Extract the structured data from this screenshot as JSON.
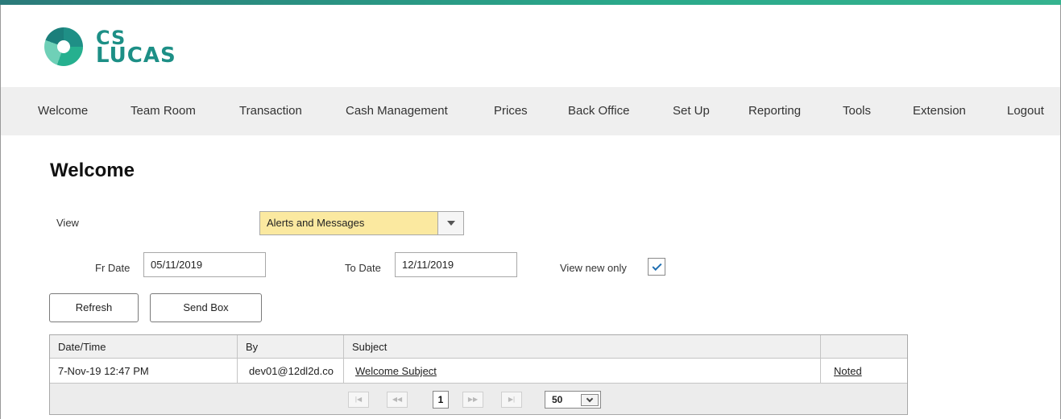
{
  "brand": {
    "line1": "CS",
    "line2": "LUCAS",
    "primary_color": "#1d8f86"
  },
  "nav": {
    "items": [
      {
        "label": "Welcome"
      },
      {
        "label": "Team Room"
      },
      {
        "label": "Transaction"
      },
      {
        "label": "Cash Management"
      },
      {
        "label": "Prices"
      },
      {
        "label": "Back Office"
      },
      {
        "label": "Set Up"
      },
      {
        "label": "Reporting"
      },
      {
        "label": "Tools"
      },
      {
        "label": "Extension"
      },
      {
        "label": "Logout"
      }
    ]
  },
  "page": {
    "title": "Welcome"
  },
  "filters": {
    "view_label": "View",
    "view_value": "Alerts and Messages",
    "from_date_label": "Fr Date",
    "from_date_value": "05/11/2019",
    "to_date_label": "To Date",
    "to_date_value": "12/11/2019",
    "new_only_label": "View new only",
    "new_only_checked": true
  },
  "actions": {
    "refresh_label": "Refresh",
    "send_box_label": "Send Box"
  },
  "grid": {
    "columns": [
      "Date/Time",
      "By",
      "Subject",
      ""
    ],
    "rows": [
      {
        "datetime": "7-Nov-19 12:47 PM",
        "by": "dev01@12dl2d.co",
        "subject": "Welcome Subject",
        "action": "Noted"
      }
    ],
    "pager": {
      "first": "|◀",
      "prev": "◀◀",
      "current_page": "1",
      "next": "▶▶",
      "last": "▶|",
      "page_size": "50"
    }
  }
}
